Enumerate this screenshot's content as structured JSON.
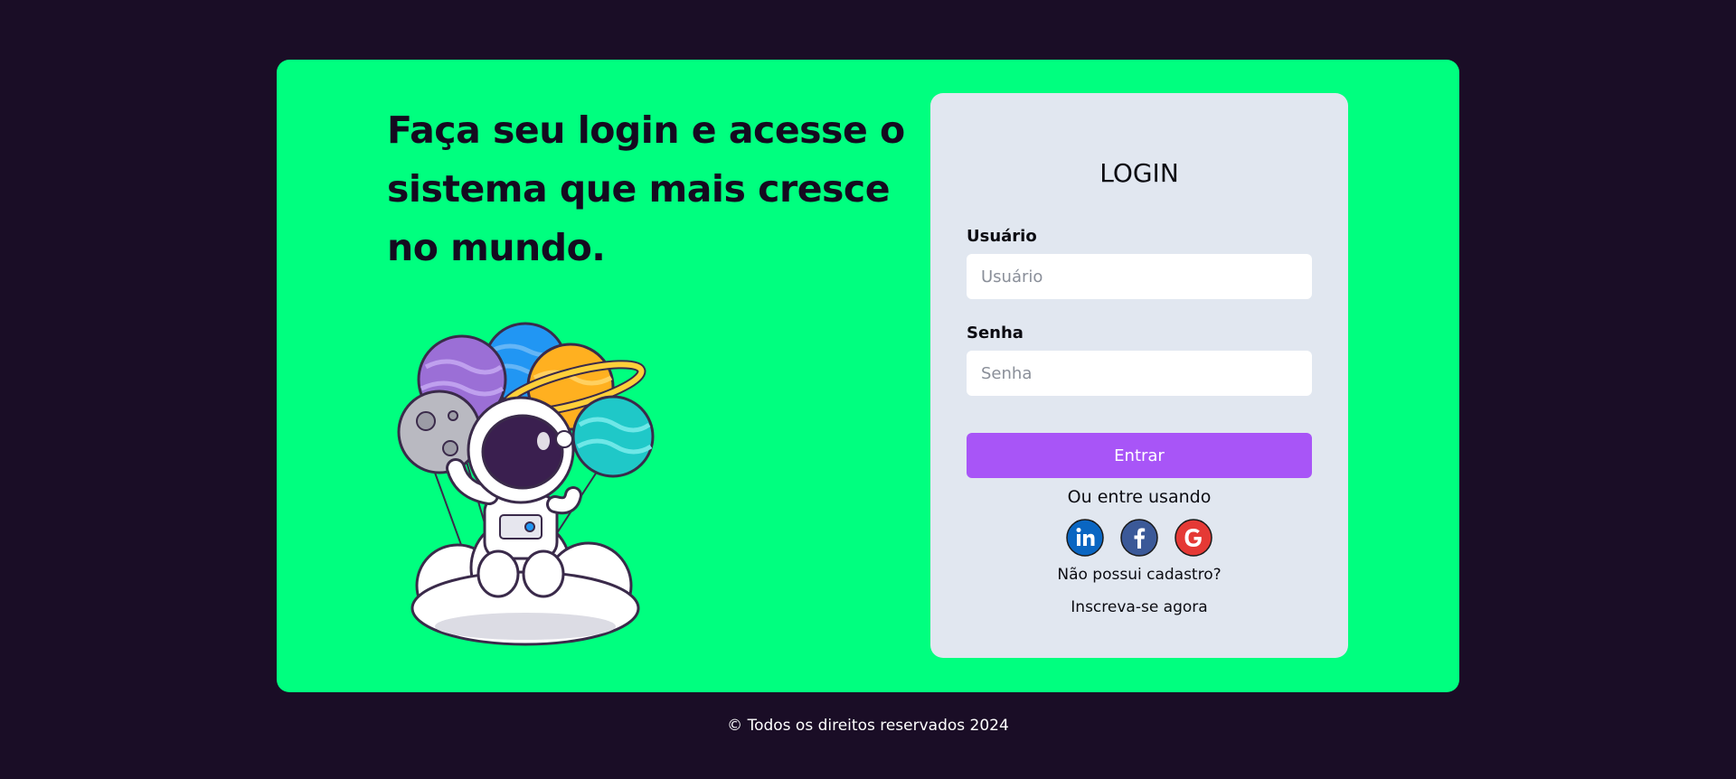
{
  "hero": {
    "headline": "Faça seu login e acesse o sistema que mais cresce no mundo.",
    "illustration": "astronaut-with-planet-balloons-on-cloud"
  },
  "login": {
    "title": "LOGIN",
    "username": {
      "label": "Usuário",
      "placeholder": "Usuário",
      "value": ""
    },
    "password": {
      "label": "Senha",
      "placeholder": "Senha",
      "value": ""
    },
    "submit_label": "Entrar",
    "alt_login_text": "Ou entre usando",
    "socials": [
      {
        "name": "linkedin",
        "icon": "linkedin-icon",
        "color": "#0a66c2"
      },
      {
        "name": "facebook",
        "icon": "facebook-icon",
        "color": "#3b5998"
      },
      {
        "name": "google",
        "icon": "google-icon",
        "color": "#e53935"
      }
    ],
    "no_account_text": "Não possui cadastro?",
    "signup_label": "Inscreva-se agora"
  },
  "footer": {
    "text": "© Todos os direitos reservados 2024"
  },
  "colors": {
    "background": "#1a0d26",
    "card": "#00ff7f",
    "panel": "#e1e7f0",
    "accent": "#a855f7"
  }
}
